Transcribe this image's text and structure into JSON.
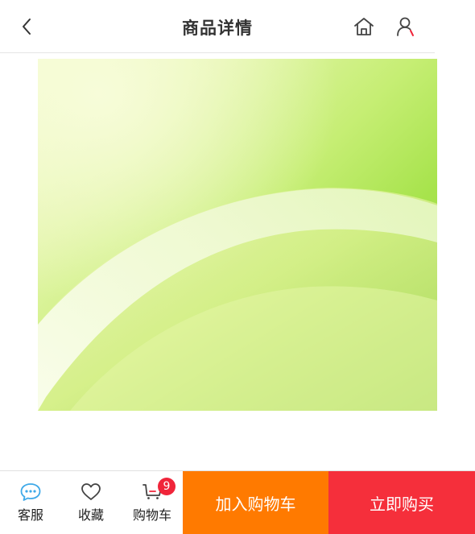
{
  "header": {
    "title": "商品详情",
    "back_icon": "chevron-left-icon",
    "home_icon": "home-icon",
    "user_icon": "user-icon"
  },
  "product": {
    "image_colors": {
      "top_left": "#f4fbd2",
      "top_right": "#9fd94e",
      "band": "#f7fde8"
    }
  },
  "bottom_bar": {
    "service": {
      "label": "客服",
      "icon": "chat-bubble-icon",
      "color": "#3fa9e8"
    },
    "favorite": {
      "label": "收藏",
      "icon": "heart-icon"
    },
    "cart": {
      "label": "购物车",
      "icon": "cart-icon",
      "badge": "9",
      "badge_color": "#f0253a"
    },
    "add_to_cart": {
      "label": "加入购物车",
      "color": "#ff7a00"
    },
    "buy_now": {
      "label": "立即购买",
      "color": "#f52f3b"
    }
  }
}
